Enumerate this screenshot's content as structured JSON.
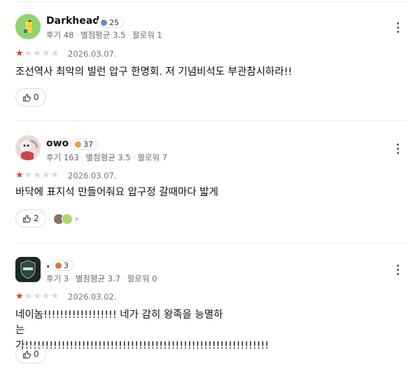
{
  "reviews": [
    {
      "username": "Darkhead",
      "badge": "25",
      "stats": {
        "reviews": "후기 48",
        "avg": "별점평균 3.5",
        "followers": "팔로워 1"
      },
      "rating": 1,
      "date": "2026.03.07.",
      "text": "조선역사 최악의 빌런 압구 한명회. 저 기념비석도 부관참시하라!!",
      "likes": "0"
    },
    {
      "username": "owo",
      "badge": "37",
      "stats": {
        "reviews": "후기 163",
        "avg": "별점평균 3.5",
        "followers": "팔로워 7"
      },
      "rating": 1,
      "date": "2026.03.07.",
      "text": "바닥에 표지석 만들어줘요 압구정 갈때마다 밟게",
      "likes": "2"
    },
    {
      "username": ".",
      "badge": "3",
      "stats": {
        "reviews": "후기 3",
        "avg": "별점평균 3.7",
        "followers": "팔로워 0"
      },
      "rating": 1,
      "date": "2026.03.02.",
      "text": "네이놈!!!!!!!!!!!!!!!!!! 네가 감히 왕족을 능멸하는가!!!!!!!!!!!!!!!!!!!!!!!!!!!!!!!!!!!!!!!!!!!!!!!!!!!!!!!!!!!!",
      "likes": "0"
    }
  ],
  "colors": {
    "star_on": "#e23b2e",
    "star_off": "#d9d9d9",
    "badge_blue": "#6b86c9",
    "badge_gold": "#e6a532",
    "badge_orange": "#d9773a"
  },
  "icons": {
    "like": "thumbs-up-icon",
    "more": "more-vertical-icon"
  }
}
